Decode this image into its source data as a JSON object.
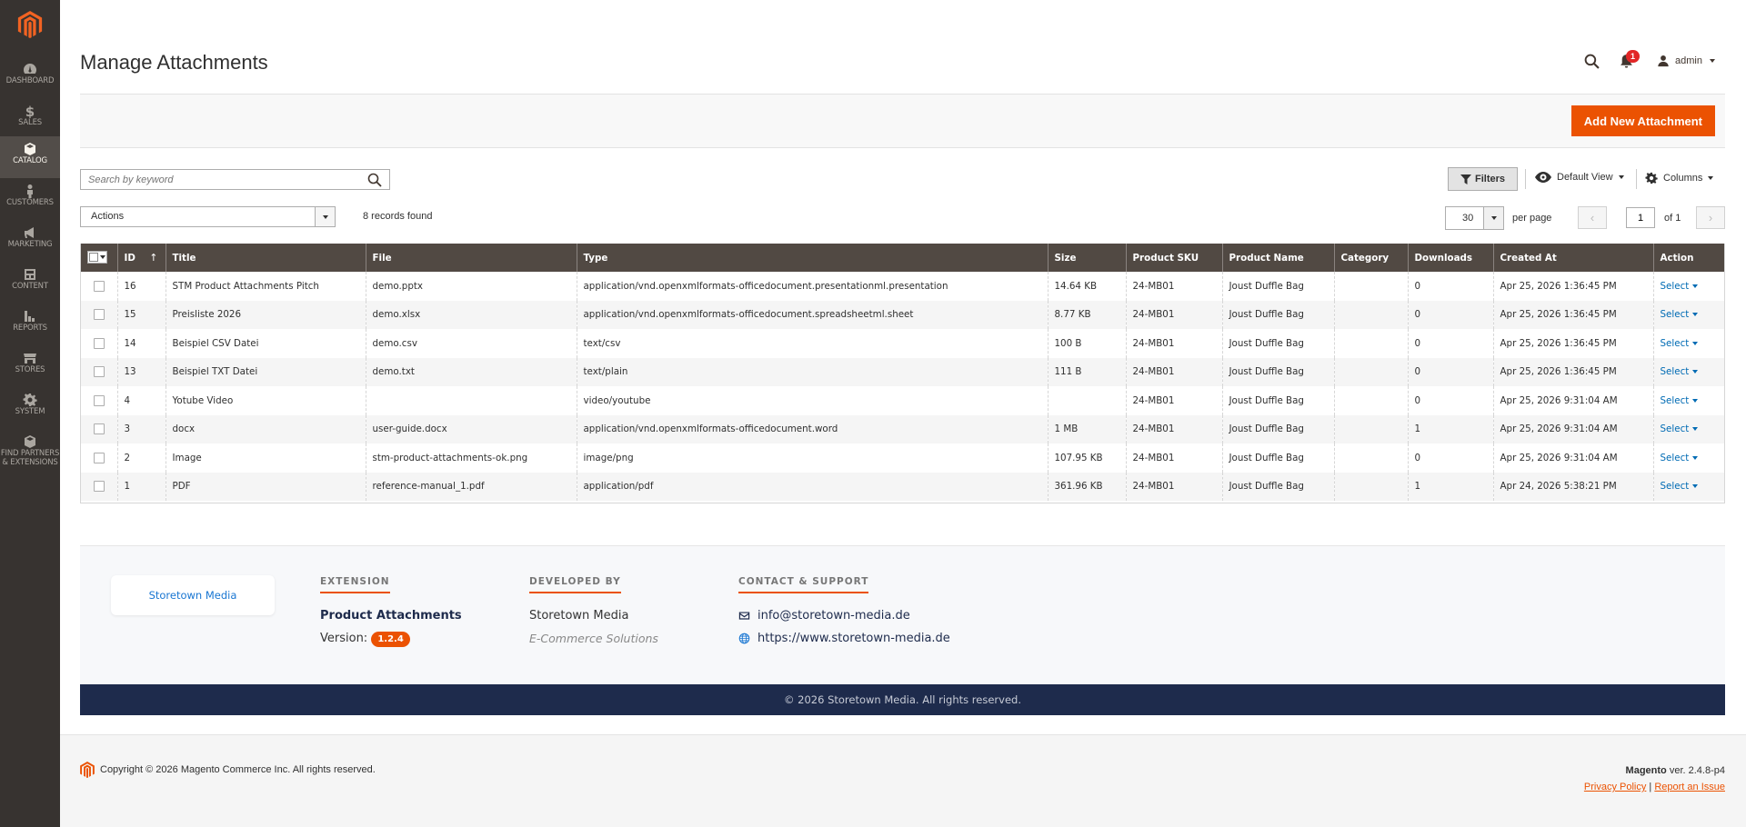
{
  "sidebar": {
    "items": [
      {
        "label": "Dashboard",
        "icon": "dashboard-icon"
      },
      {
        "label": "Sales",
        "icon": "dollar-icon"
      },
      {
        "label": "Catalog",
        "icon": "box-icon"
      },
      {
        "label": "Customers",
        "icon": "person-icon"
      },
      {
        "label": "Marketing",
        "icon": "megaphone-icon"
      },
      {
        "label": "Content",
        "icon": "layout-icon"
      },
      {
        "label": "Reports",
        "icon": "bar-chart-icon"
      },
      {
        "label": "Stores",
        "icon": "store-icon"
      },
      {
        "label": "System",
        "icon": "gear-icon"
      },
      {
        "label_line1": "Find Partners",
        "label_line2": "& Extensions",
        "icon": "cube-icon"
      }
    ],
    "active_index": 2
  },
  "header": {
    "title": "Manage Attachments",
    "notification_count": "1",
    "user": "admin"
  },
  "action_bar": {
    "add_button": "Add New Attachment"
  },
  "grid_controls": {
    "search_placeholder": "Search by keyword",
    "filters_label": "Filters",
    "view_label": "Default View",
    "columns_label": "Columns",
    "actions_label": "Actions",
    "records_found": "8 records found",
    "per_page_value": "30",
    "per_page_label": "per page",
    "current_page": "1",
    "page_of": "of 1"
  },
  "table": {
    "columns": [
      "ID",
      "Title",
      "File",
      "Type",
      "Size",
      "Product SKU",
      "Product Name",
      "Category",
      "Downloads",
      "Created At",
      "Action"
    ],
    "rows": [
      {
        "id": "16",
        "title": "STM Product Attachments Pitch",
        "file": "demo.pptx",
        "type": "application/vnd.openxmlformats-officedocument.presentationml.presentation",
        "size": "14.64 KB",
        "sku": "24-MB01",
        "product": "Joust Duffle Bag",
        "category": "",
        "downloads": "0",
        "created": "Apr 25, 2026 1:36:45 PM",
        "action": "Select"
      },
      {
        "id": "15",
        "title": "Preisliste 2026",
        "file": "demo.xlsx",
        "type": "application/vnd.openxmlformats-officedocument.spreadsheetml.sheet",
        "size": "8.77 KB",
        "sku": "24-MB01",
        "product": "Joust Duffle Bag",
        "category": "",
        "downloads": "0",
        "created": "Apr 25, 2026 1:36:45 PM",
        "action": "Select"
      },
      {
        "id": "14",
        "title": "Beispiel CSV Datei",
        "file": "demo.csv",
        "type": "text/csv",
        "size": "100 B",
        "sku": "24-MB01",
        "product": "Joust Duffle Bag",
        "category": "",
        "downloads": "0",
        "created": "Apr 25, 2026 1:36:45 PM",
        "action": "Select"
      },
      {
        "id": "13",
        "title": "Beispiel TXT Datei",
        "file": "demo.txt",
        "type": "text/plain",
        "size": "111 B",
        "sku": "24-MB01",
        "product": "Joust Duffle Bag",
        "category": "",
        "downloads": "0",
        "created": "Apr 25, 2026 1:36:45 PM",
        "action": "Select"
      },
      {
        "id": "4",
        "title": "Yotube Video",
        "file": "",
        "type": "video/youtube",
        "size": "",
        "sku": "24-MB01",
        "product": "Joust Duffle Bag",
        "category": "",
        "downloads": "0",
        "created": "Apr 25, 2026 9:31:04 AM",
        "action": "Select"
      },
      {
        "id": "3",
        "title": "docx",
        "file": "user-guide.docx",
        "type": "application/vnd.openxmlformats-officedocument.word",
        "size": "1 MB",
        "sku": "24-MB01",
        "product": "Joust Duffle Bag",
        "category": "",
        "downloads": "1",
        "created": "Apr 25, 2026 9:31:04 AM",
        "action": "Select"
      },
      {
        "id": "2",
        "title": "Image",
        "file": "stm-product-attachments-ok.png",
        "type": "image/png",
        "size": "107.95 KB",
        "sku": "24-MB01",
        "product": "Joust Duffle Bag",
        "category": "",
        "downloads": "0",
        "created": "Apr 25, 2026 9:31:04 AM",
        "action": "Select"
      },
      {
        "id": "1",
        "title": "PDF",
        "file": "reference-manual_1.pdf",
        "type": "application/pdf",
        "size": "361.96 KB",
        "sku": "24-MB01",
        "product": "Joust Duffle Bag",
        "category": "",
        "downloads": "1",
        "created": "Apr 24, 2026 5:38:21 PM",
        "action": "Select"
      }
    ]
  },
  "extension_footer": {
    "logo_text": "Storetown Media",
    "extension_heading": "EXTENSION",
    "extension_name": "Product Attachments",
    "version_label": "Version:",
    "version": "1.2.4",
    "developed_heading": "DEVELOPED BY",
    "developer": "Storetown Media",
    "developer_tagline": "E-Commerce Solutions",
    "contact_heading": "CONTACT & SUPPORT",
    "email": "info@storetown-media.de",
    "website": "https://www.storetown-media.de",
    "copyright": "© 2026 Storetown Media. All rights reserved."
  },
  "page_footer": {
    "copyright": "Copyright © 2026 Magento Commerce Inc. All rights reserved.",
    "brand": "Magento",
    "version": "ver. 2.4.8-p4",
    "privacy_link": "Privacy Policy",
    "separator": "|",
    "report_link": "Report an Issue"
  },
  "colors": {
    "sidebar_bg": "#373330",
    "accent": "#eb5202",
    "grid_header": "#514943",
    "link": "#006bb4",
    "footer_bar": "#1e2b4c"
  }
}
